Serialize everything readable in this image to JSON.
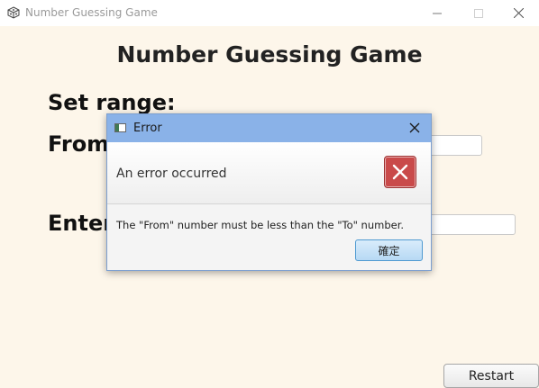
{
  "window": {
    "title": "Number Guessing Game",
    "icon": "dice-icon"
  },
  "main": {
    "heading": "Number Guessing Game",
    "set_range_label": "Set range:",
    "from_label": "From",
    "enter_label": "Enter",
    "restart_label": "Restart"
  },
  "dialog": {
    "title": "Error",
    "header_text": "An error occurred",
    "message": "The \"From\" number must be less than the \"To\" number.",
    "ok_label": "確定",
    "icon": "error-icon"
  },
  "colors": {
    "background": "#fdf6ea",
    "dialog_titlebar": "#8ab2e8",
    "error_red": "#c94a4a",
    "ok_button": "#b7d9f4"
  }
}
